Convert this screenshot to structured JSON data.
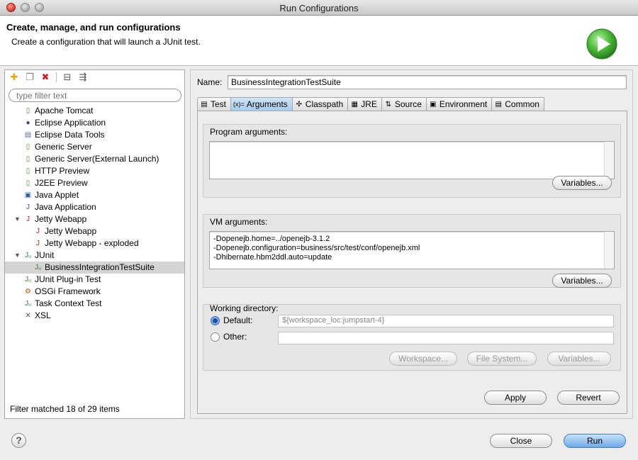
{
  "window": {
    "title": "Run Configurations"
  },
  "header": {
    "title": "Create, manage, and run configurations",
    "description": "Create a configuration that will launch a JUnit test.",
    "run_icon": "run-play-icon"
  },
  "sidebar": {
    "toolbar": [
      {
        "name": "new-config-icon",
        "glyph": "✚"
      },
      {
        "name": "duplicate-config-icon",
        "glyph": "❐"
      },
      {
        "name": "delete-config-icon",
        "glyph": "✖"
      },
      {
        "name": "collapse-all-icon",
        "glyph": "⊟"
      },
      {
        "name": "filter-icon",
        "glyph": "⇶"
      }
    ],
    "filter_placeholder": "type filter text",
    "tree": [
      {
        "label": "Apache Tomcat",
        "indent": 1,
        "icon": "server-icon",
        "glyph": "▯"
      },
      {
        "label": "Eclipse Application",
        "indent": 1,
        "icon": "eclipse-icon",
        "glyph": "●"
      },
      {
        "label": "Eclipse Data Tools",
        "indent": 1,
        "icon": "data-tools-icon",
        "glyph": "▤"
      },
      {
        "label": "Generic Server",
        "indent": 1,
        "icon": "server-icon",
        "glyph": "▯"
      },
      {
        "label": "Generic Server(External Launch)",
        "indent": 1,
        "icon": "server-icon",
        "glyph": "▯"
      },
      {
        "label": "HTTP Preview",
        "indent": 1,
        "icon": "server-icon",
        "glyph": "▯"
      },
      {
        "label": "J2EE Preview",
        "indent": 1,
        "icon": "server-icon",
        "glyph": "▯"
      },
      {
        "label": "Java Applet",
        "indent": 1,
        "icon": "applet-icon",
        "glyph": "▣"
      },
      {
        "label": "Java Application",
        "indent": 1,
        "icon": "java-app-icon",
        "glyph": "J"
      },
      {
        "label": "Jetty Webapp",
        "indent": 1,
        "icon": "jetty-icon",
        "glyph": "J",
        "expanded": true
      },
      {
        "label": "Jetty Webapp",
        "indent": 2,
        "icon": "jetty-icon",
        "glyph": "J"
      },
      {
        "label": "Jetty Webapp - exploded",
        "indent": 2,
        "icon": "jetty-icon",
        "glyph": "J"
      },
      {
        "label": "JUnit",
        "indent": 1,
        "icon": "junit-icon",
        "glyph": "Jᵤ",
        "expanded": true
      },
      {
        "label": "BusinessIntegrationTestSuite",
        "indent": 2,
        "icon": "junit-icon",
        "glyph": "Jᵤ",
        "selected": true
      },
      {
        "label": "JUnit Plug-in Test",
        "indent": 1,
        "icon": "junit-plugin-icon",
        "glyph": "Jᵤ"
      },
      {
        "label": "OSGi Framework",
        "indent": 1,
        "icon": "osgi-icon",
        "glyph": "⚙"
      },
      {
        "label": "Task Context Test",
        "indent": 1,
        "icon": "task-context-icon",
        "glyph": "Jᵤ"
      },
      {
        "label": "XSL",
        "indent": 1,
        "icon": "xsl-icon",
        "glyph": "✕"
      }
    ],
    "status": "Filter matched 18 of 29 items"
  },
  "main": {
    "name_label": "Name:",
    "name_value": "BusinessIntegrationTestSuite",
    "tabs": [
      {
        "label": "Test",
        "icon": "test-tab-icon",
        "glyph": "▤"
      },
      {
        "label": "Arguments",
        "icon": "arguments-tab-icon",
        "glyph": "(x)=",
        "active": true
      },
      {
        "label": "Classpath",
        "icon": "classpath-tab-icon",
        "glyph": "✣"
      },
      {
        "label": "JRE",
        "icon": "jre-tab-icon",
        "glyph": "▦"
      },
      {
        "label": "Source",
        "icon": "source-tab-icon",
        "glyph": "⇅"
      },
      {
        "label": "Environment",
        "icon": "environment-tab-icon",
        "glyph": "▣"
      },
      {
        "label": "Common",
        "icon": "common-tab-icon",
        "glyph": "▤"
      }
    ],
    "program_args_label": "Program arguments:",
    "program_args_value": "",
    "vm_args_label": "VM arguments:",
    "vm_args_lines": [
      "-Dopenejb.home=../openejb-3.1.2",
      "-Dopenejb.configuration=business/src/test/conf/openejb.xml",
      "-Dhibernate.hbm2ddl.auto=update"
    ],
    "variables_label": "Variables...",
    "working_dir_label": "Working directory:",
    "default_label": "Default:",
    "default_value": "${workspace_loc:jumpstart-4}",
    "other_label": "Other:",
    "other_value": "",
    "workspace_btn": "Workspace...",
    "filesystem_btn": "File System...",
    "variables_btn": "Variables...",
    "apply_btn": "Apply",
    "revert_btn": "Revert"
  },
  "footer": {
    "help_glyph": "?",
    "close_btn": "Close",
    "run_btn": "Run"
  },
  "colors": {
    "selection": "#d4d4d4",
    "active_tab": "#a8cbeb",
    "run_green": "#3aa62e",
    "primary_button": "#6fa9e6"
  }
}
